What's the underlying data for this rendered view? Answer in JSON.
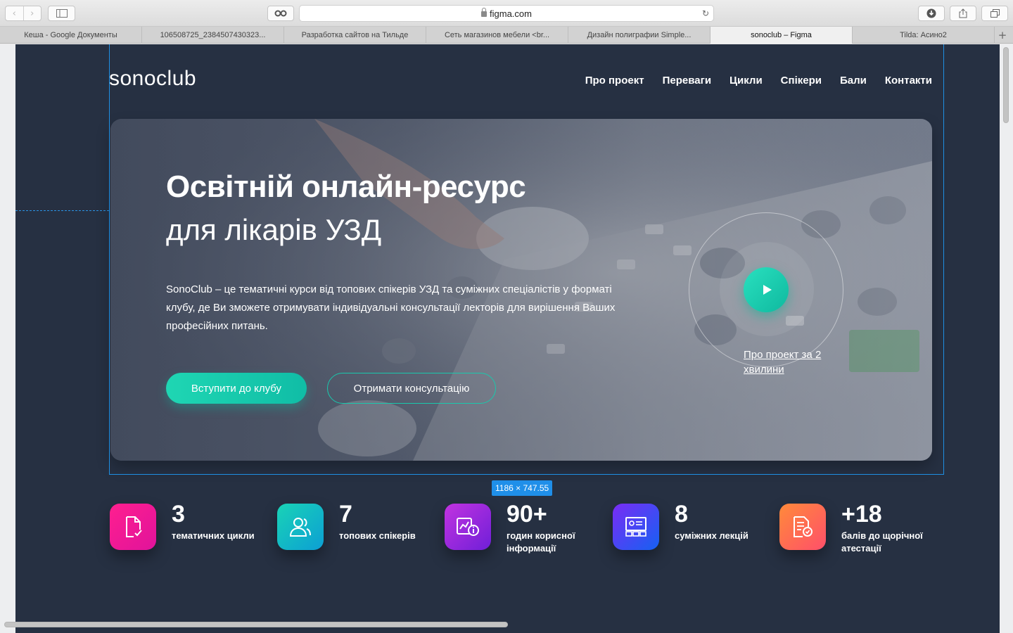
{
  "browser": {
    "url": "figma.com",
    "tabs": [
      {
        "label": "Кеша - Google Документы",
        "active": false
      },
      {
        "label": "106508725_2384507430323...",
        "active": false
      },
      {
        "label": "Разработка сайтов на Тильде",
        "active": false
      },
      {
        "label": "Сеть магазинов мебели <br...",
        "active": false
      },
      {
        "label": "Дизайн полиграфии Simple...",
        "active": false
      },
      {
        "label": "sonoclub – Figma",
        "active": true
      },
      {
        "label": "Tilda: Асино2",
        "active": false
      }
    ]
  },
  "figma": {
    "selection_size": "1186 × 747.55"
  },
  "site": {
    "logo": "sonoclub",
    "nav": [
      "Про проект",
      "Переваги",
      "Цикли",
      "Спікери",
      "Бали",
      "Контакти"
    ],
    "hero": {
      "title": "Освітній онлайн-ресурс",
      "subtitle": "для лікарів УЗД",
      "description": "SonoClub – це тематичні курси від топових спікерів УЗД та суміжних спеціалістів у форматі клубу, де Ви зможете отримувати індивідуальні консультації лекторів для вирішення Ваших професійних питань.",
      "primary_button": "Вступити до клубу",
      "secondary_button": "Отримати консультацію",
      "video_label": "Про проект за 2 хвилини"
    },
    "stats": [
      {
        "number": "3",
        "label": "тематичних цикли",
        "icon": "document-check-icon",
        "gradient": [
          "#ff1f8f",
          "#e0139b"
        ]
      },
      {
        "number": "7",
        "label": "топових спікерів",
        "icon": "users-icon",
        "gradient": [
          "#19d3b6",
          "#0c9fd4"
        ]
      },
      {
        "number": "90+",
        "label": "годин корисної інформації",
        "icon": "chart-info-icon",
        "gradient": [
          "#c233e0",
          "#6f1fd8"
        ]
      },
      {
        "number": "8",
        "label": "суміжних лекцій",
        "icon": "presentation-icon",
        "gradient": [
          "#7a2cf5",
          "#1561f2"
        ]
      },
      {
        "number": "+18",
        "label": "балів до щорічної атестації",
        "icon": "certificate-icon",
        "gradient": [
          "#ff8a3a",
          "#ff4f6a"
        ]
      }
    ]
  }
}
